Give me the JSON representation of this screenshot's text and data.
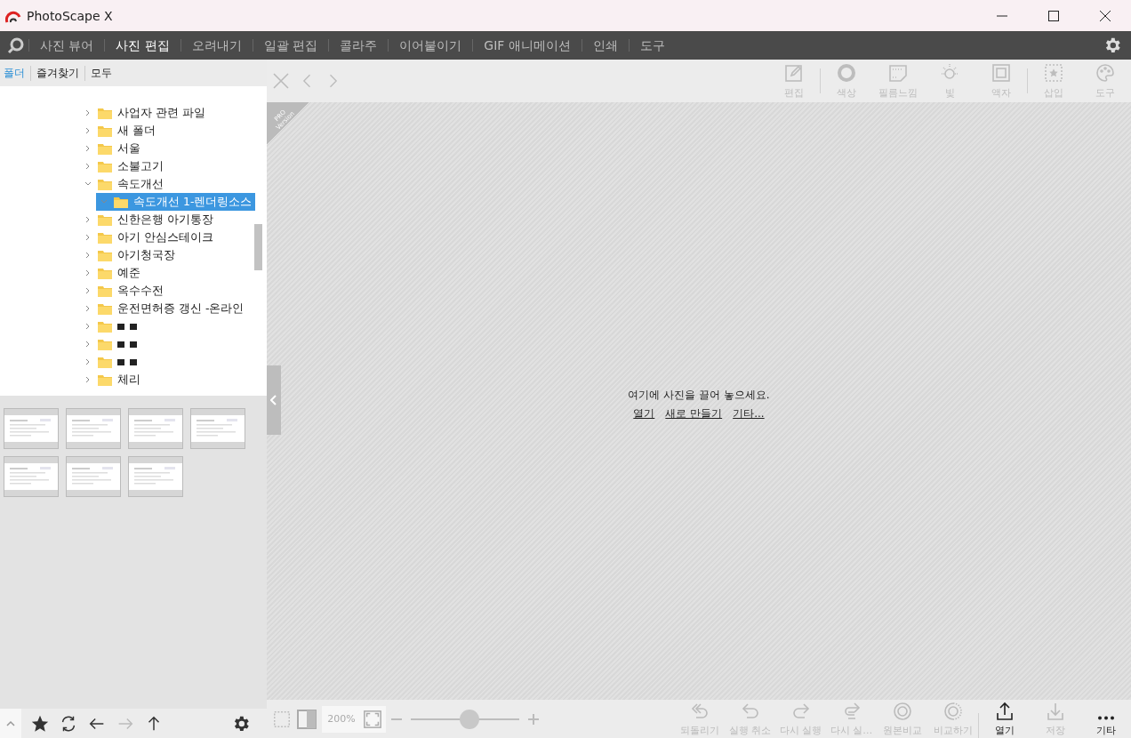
{
  "window": {
    "title": "PhotoScape X"
  },
  "menu": [
    {
      "label": "사진 뷰어",
      "selected": false
    },
    {
      "label": "사진 편집",
      "selected": true
    },
    {
      "label": "오려내기",
      "selected": false
    },
    {
      "label": "일괄 편집",
      "selected": false
    },
    {
      "label": "콜라주",
      "selected": false
    },
    {
      "label": "이어붙이기",
      "selected": false
    },
    {
      "label": "GIF 애니메이션",
      "selected": false
    },
    {
      "label": "인쇄",
      "selected": false
    },
    {
      "label": "도구",
      "selected": false
    }
  ],
  "sidebar_tabs": [
    {
      "label": "폴더",
      "selected": true
    },
    {
      "label": "즐겨찾기",
      "selected": false
    },
    {
      "label": "모두",
      "selected": false
    }
  ],
  "tree": [
    {
      "label": "사업자 관련 파일",
      "expanded": false,
      "selected": false
    },
    {
      "label": "새 폴더",
      "expanded": false,
      "selected": false
    },
    {
      "label": "서울",
      "expanded": false,
      "selected": false
    },
    {
      "label": "소불고기",
      "expanded": false,
      "selected": false
    },
    {
      "label": "속도개선",
      "expanded": true,
      "selected": false,
      "children": [
        {
          "label": "속도개선 1-렌더링소스",
          "expanded": true,
          "selected": true
        }
      ]
    },
    {
      "label": "신한은행 아기통장",
      "expanded": false,
      "selected": false
    },
    {
      "label": "아기 안심스테이크",
      "expanded": false,
      "selected": false
    },
    {
      "label": "아기청국장",
      "expanded": false,
      "selected": false
    },
    {
      "label": "예준",
      "expanded": false,
      "selected": false
    },
    {
      "label": "옥수수전",
      "expanded": false,
      "selected": false
    },
    {
      "label": "운전면허증 갱신 -온라인",
      "expanded": false,
      "selected": false
    },
    {
      "kind": "redacted",
      "expanded": false,
      "selected": false
    },
    {
      "kind": "redacted",
      "expanded": false,
      "selected": false
    },
    {
      "kind": "redacted",
      "expanded": false,
      "selected": false
    },
    {
      "label": "체리",
      "expanded": false,
      "selected": false
    }
  ],
  "tools": [
    {
      "label": "편집",
      "disabled": true
    },
    {
      "label": "색상",
      "disabled": true
    },
    {
      "label": "필름느낌",
      "disabled": true
    },
    {
      "label": "빛",
      "disabled": true
    },
    {
      "label": "액자",
      "disabled": true
    },
    {
      "label": "삽입",
      "disabled": true
    },
    {
      "label": "도구",
      "disabled": true
    }
  ],
  "canvas": {
    "badge": "PRO Version",
    "message": "여기에 사진을 끌어 놓으세요.",
    "links": [
      "열기",
      "새로 만들기",
      "기타..."
    ]
  },
  "zoom": {
    "value": "200%"
  },
  "actions": [
    {
      "label": "되돌리기",
      "disabled": true
    },
    {
      "label": "실행 취소",
      "disabled": true
    },
    {
      "label": "다시 실행",
      "disabled": true
    },
    {
      "label": "다시 실…",
      "disabled": true
    },
    {
      "label": "원본비교",
      "disabled": true
    },
    {
      "label": "비교하기",
      "disabled": true
    },
    {
      "label": "열기",
      "disabled": false
    },
    {
      "label": "저장",
      "disabled": true
    },
    {
      "label": "기타",
      "disabled": false
    }
  ]
}
